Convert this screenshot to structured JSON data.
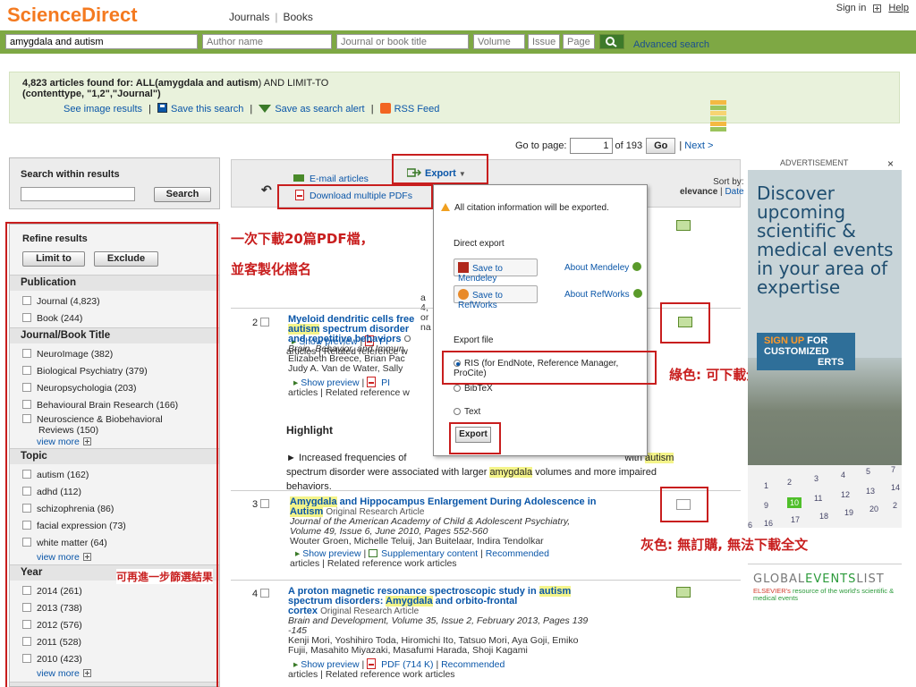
{
  "header": {
    "logo": "ScienceDirect",
    "nav_journals": "Journals",
    "nav_sep": "|",
    "nav_books": "Books",
    "sign_in": "Sign in",
    "help": "Help"
  },
  "search": {
    "keywords": "amygdala and autism",
    "author_placeholder": "Author name",
    "journal_placeholder": "Journal or book title",
    "volume_placeholder": "Volume",
    "issue_placeholder": "Issue",
    "page_placeholder": "Page",
    "advanced": "Advanced search"
  },
  "info": {
    "count": "4,823",
    "found_text": "articles found for: ALL(",
    "query_bold": "amygdala and autism",
    "query_rest": ") AND LIMIT-TO",
    "query_line2": "(contenttype, \"1,2\",\"Journal\")",
    "see_images": "See image results",
    "save_search": "Save this search",
    "save_alert": "Save as search alert",
    "rss": "RSS Feed",
    "sep": "|"
  },
  "pager": {
    "label": "Go to page:",
    "current": "1",
    "of": "of 193",
    "go": "Go",
    "sep": "|",
    "next": "Next >"
  },
  "search_within": {
    "title": "Search within results",
    "button": "Search"
  },
  "refine": {
    "title": "Refine results",
    "limit_to": "Limit to",
    "exclude": "Exclude",
    "publication_title": "Publication",
    "publication": [
      "Journal (4,823)",
      "Book (244)"
    ],
    "journal_title": "Journal/Book Title",
    "journals": [
      "NeuroImage (382)",
      "Biological Psychiatry (379)",
      "Neuropsychologia (203)",
      "Behavioural Brain Research (166)",
      "Neuroscience & Biobehavioral",
      "Reviews (150)"
    ],
    "topic_title": "Topic",
    "topics": [
      "autism (162)",
      "adhd (112)",
      "schizophrenia (86)",
      "facial expression (73)",
      "white matter (64)"
    ],
    "year_title": "Year",
    "years": [
      "2014 (261)",
      "2013 (738)",
      "2012 (576)",
      "2011 (528)",
      "2010 (423)"
    ],
    "view_more": "view more"
  },
  "toolbar": {
    "email": "E-mail articles",
    "download_pdfs": "Download multiple PDFs",
    "export": "Export",
    "export_caret": "▼",
    "sort_by": "Sort by:",
    "relevance": "elevance",
    "sort_sep": "|",
    "date": "Date",
    "back_arrow": "↶"
  },
  "results": {
    "r0_line1": "a",
    "r0_line2": "4,",
    "r0_line3": "or",
    "r0_line4": "na",
    "show_preview": "Show preview",
    "pdf_short": "PI",
    "articles_related": "articles | Related reference w",
    "r1_num": "2",
    "r1_title_a": "Myeloid dendritic cells free",
    "r1_title_b_hl": "autism",
    "r1_title_b": " spectrum disorder",
    "r1_title_c": "and repetitive behaviors",
    "r1_title_c_tail": "O",
    "r1_jour": "Brain, Behavior, and Immun",
    "r1_auth1": "Elizabeth Breece, Brian Pac",
    "r1_auth2": "Judy A. Van de Water, Sally",
    "highlight_title": "Highlight",
    "hl_text_a": "► Increased frequencies of",
    "hl_with": "with",
    "hl_autism": "autism",
    "hl_text_b": "spectrum disorder were associated with larger",
    "hl_amyg": "amygdala",
    "hl_text_c": "volumes and more impaired",
    "hl_text_d": "behaviors.",
    "r2_num": "3",
    "r2_title_a_hl": "Amygdala",
    "r2_title_a": " and Hippocampus Enlargement During Adolescence in",
    "r2_title_b_hl": "Autism",
    "r2_type": "Original Research Article",
    "r2_jour1": "Journal of the American Academy of Child & Adolescent Psychiatry,",
    "r2_jour2": "Volume 49, Issue 6, June 2010, Pages 552-560",
    "r2_auth": "Wouter Groen, Michelle Teluij, Jan Buitelaar, Indira Tendolkar",
    "r2_supp": "Supplementary content",
    "r2_recommended": "Recommended",
    "r2_related": "articles | Related reference work articles",
    "r3_num": "4",
    "r3_title_a": "A proton magnetic resonance spectroscopic study in",
    "r3_title_a_hl": "autism",
    "r3_title_b": "spectrum disorders:",
    "r3_title_b_hl": "Amygdala",
    "r3_title_b_tail": "and orbito-frontal",
    "r3_title_c": "cortex",
    "r3_type": "Original Research Article",
    "r3_jour1": "Brain and Development, Volume 35, Issue 2, February 2013, Pages 139",
    "r3_jour2": "-145",
    "r3_auth1": "Kenji Mori, Yoshihiro Toda, Hiromichi Ito, Tatsuo Mori, Aya Goji, Emiko",
    "r3_auth2": "Fujii, Masahito Miyazaki, Masafumi Harada, Shoji Kagami",
    "r3_pdf": "PDF (714 K)",
    "r3_recommended": "Recommended",
    "r3_related": "articles | Related reference work articles",
    "sep": "|"
  },
  "export_popup": {
    "warning": "All citation information will be exported.",
    "direct_export": "Direct export",
    "save_mendeley": "Save to Mendeley",
    "about_mendeley": "About Mendeley",
    "save_refworks": "Save to RefWorks",
    "about_refworks": "About RefWorks",
    "export_file": "Export file",
    "ris": "RIS (for EndNote, Reference Manager, ProCite)",
    "bibtex": "BibTeX",
    "text": "Text",
    "export_btn": "Export"
  },
  "annotations": {
    "download20": "一次下載20篇PDF檔，",
    "custom_name": "並客製化檔名",
    "green": "綠色: 可下載全文",
    "gray": "灰色: 無訂購, 無法下載全文",
    "filter": "可再進一步篩選結果"
  },
  "ad": {
    "label": "ADVERTISEMENT",
    "close": "×",
    "text": "Discover upcoming scientific & medical events in your area of expertise",
    "sign_up": "SIGN UP",
    "for_text": "FOR CUSTOMIZED",
    "erts": "ERTS",
    "cal": [
      "1",
      "2",
      "3",
      "4",
      "5",
      "7",
      "9",
      "10",
      "11",
      "12",
      "13",
      "14",
      "6",
      "16",
      "17",
      "18",
      "19",
      "20",
      "2"
    ],
    "gel_global": "GLOBAL",
    "gel_events": "EVENTS",
    "gel_list": "LIST",
    "gel_elsevier": "ELSEVIER's",
    "gel_sub": "resource of the world's scientific & medical events"
  },
  "colors": {
    "brand_orange": "#f47a20",
    "search_green": "#7ea844",
    "info_bg": "#e9f2dc",
    "annotation_red": "#c81e1e",
    "link_blue": "#0a56a8"
  }
}
